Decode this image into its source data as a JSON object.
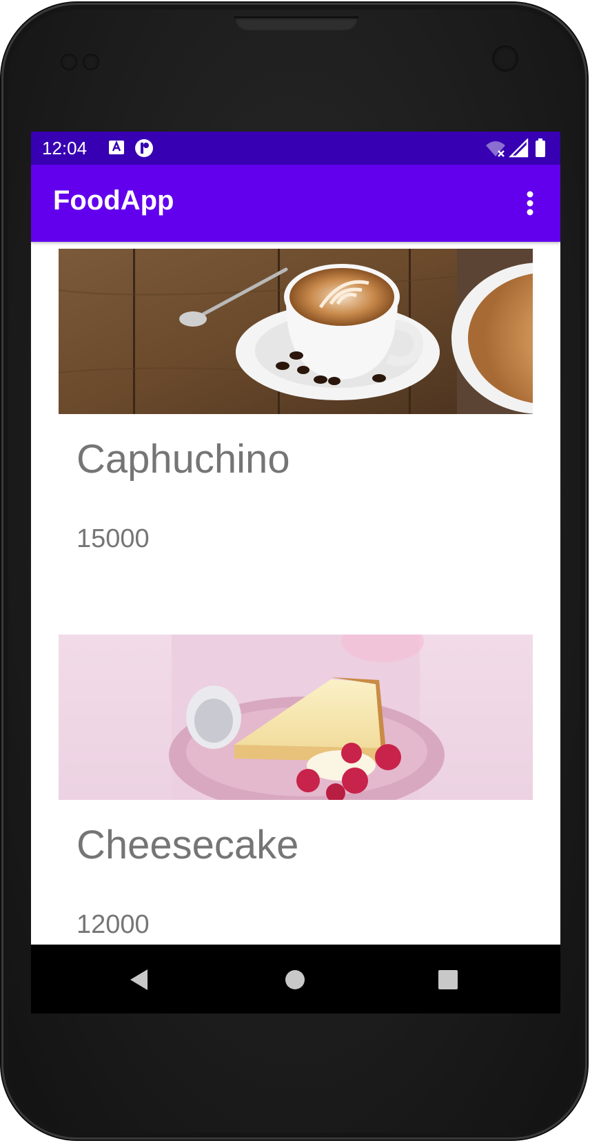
{
  "status_bar": {
    "time": "12:04"
  },
  "app_bar": {
    "title": "FoodApp"
  },
  "items": [
    {
      "name": "Caphuchino",
      "price": "15000",
      "image": "cappuccino-photo"
    },
    {
      "name": "Cheesecake",
      "price": "12000",
      "image": "cheesecake-photo"
    }
  ],
  "colors": {
    "status_bar": "#3700b3",
    "app_bar": "#6200ee",
    "text_secondary": "#757575",
    "nav_bar": "#000000"
  },
  "icons": {
    "overflow": "more-vert-icon",
    "back": "back-icon",
    "home": "home-icon",
    "recents": "recents-icon"
  }
}
